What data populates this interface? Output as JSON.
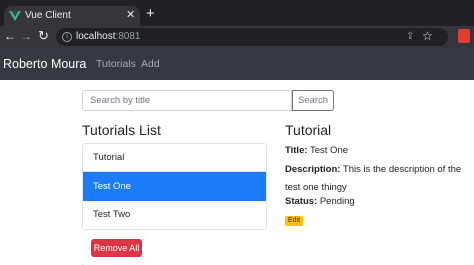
{
  "browser": {
    "tab_title": "Vue Client",
    "tab_close": "✕",
    "new_tab": "+",
    "url_host": "localhost",
    "url_port": ":8081",
    "nav_back": "←",
    "nav_forward": "→",
    "nav_reload": "↻",
    "icons": [
      "vue-logo-icon",
      "close-icon",
      "plus-icon",
      "arrow-left-icon",
      "arrow-right-icon",
      "reload-icon",
      "info-icon",
      "share-icon",
      "star-icon",
      "extension-icon"
    ]
  },
  "navbar": {
    "brand": "Roberto Moura",
    "links": [
      {
        "label": "Tutorials"
      },
      {
        "label": "Add"
      }
    ]
  },
  "search": {
    "placeholder": "Search by title",
    "button_label": "Search"
  },
  "list": {
    "title": "Tutorials List",
    "items": [
      {
        "label": "Tutorial",
        "active": false
      },
      {
        "label": "Test One",
        "active": true
      },
      {
        "label": "Test Two",
        "active": false
      }
    ],
    "remove_all_label": "Remove All"
  },
  "detail": {
    "heading": "Tutorial",
    "title_label": "Title:",
    "title_value": "Test One",
    "description_label": "Description:",
    "description_value_line1": "This is the description of the",
    "description_value_line2": "test one thingy",
    "status_label": "Status:",
    "status_value": "Pending",
    "edit_label": "Edit"
  },
  "colors": {
    "navbar_bg": "#343a40",
    "active_item": "#1a7cf6",
    "danger": "#dc3545",
    "warning": "#ffc107",
    "chrome_dark": "#202124",
    "chrome_mid": "#35363a"
  }
}
